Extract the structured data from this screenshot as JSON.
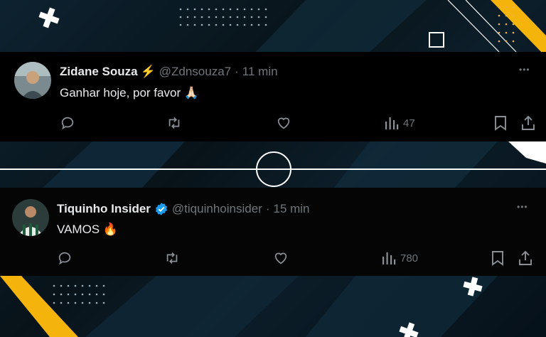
{
  "colors": {
    "accent_yellow": "#f5b40c",
    "verified_blue": "#1d9bf0",
    "lightning": "#f9b800",
    "muted": "#71767b",
    "text": "#e7e9ea"
  },
  "tweets": [
    {
      "name": "Zidane Souza",
      "name_emoji": "⚡",
      "handle": "@Zdnsouza7",
      "separator": "·",
      "time": "11 min",
      "text": "Ganhar hoje, por favor 🙏🏻",
      "verified": false,
      "more": "•••",
      "actions": {
        "reply": "reply-icon",
        "retweet": "retweet-icon",
        "like": "heart-icon",
        "views_icon": "views-icon",
        "views": "47",
        "bookmark": "bookmark-icon",
        "share": "share-icon"
      }
    },
    {
      "name": "Tiquinho Insider",
      "handle": "@tiquinhoinsider",
      "separator": "·",
      "time": "15 min",
      "text": "VAMOS 🔥",
      "verified": true,
      "more": "•••",
      "actions": {
        "reply": "reply-icon",
        "retweet": "retweet-icon",
        "like": "heart-icon",
        "views_icon": "views-icon",
        "views": "780",
        "bookmark": "bookmark-icon",
        "share": "share-icon"
      }
    }
  ]
}
